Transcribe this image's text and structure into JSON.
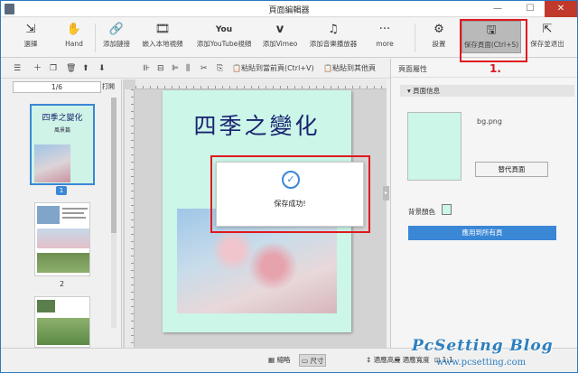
{
  "window": {
    "title": "頁面編輯器"
  },
  "toolbar": {
    "items": [
      {
        "label": "選擇",
        "icon": "selection-arrow-icon"
      },
      {
        "label": "Hand",
        "icon": "hand-icon"
      },
      {
        "label": "添加鏈接",
        "icon": "link-icon"
      },
      {
        "label": "嵌入本地視頻",
        "icon": "film-icon"
      },
      {
        "label": "添加YouTube視頻",
        "icon": "youtube-icon"
      },
      {
        "label": "添加Vimeo",
        "icon": "vimeo-icon"
      },
      {
        "label": "添加音樂播放器",
        "icon": "music-note-icon"
      },
      {
        "label": "more",
        "icon": "more-dots-icon"
      },
      {
        "label": "設置",
        "icon": "gear-icon"
      },
      {
        "label": "保存頁面(Ctrl+S)",
        "icon": "save-icon"
      },
      {
        "label": "保存並退出",
        "icon": "exit-icon"
      }
    ]
  },
  "step_marker": "1.",
  "subbar": {
    "paste_current": "粘貼到當前頁(Ctrl+V)",
    "paste_other": "粘貼到其他頁"
  },
  "left_panel": {
    "page_counter": "1/6",
    "print": "打開",
    "thumb1_title": "四季之變化",
    "thumb1_subtitle": "風景篇",
    "page_labels": [
      "1",
      "2"
    ]
  },
  "page": {
    "title": "四季之變化"
  },
  "dialog": {
    "message": "保存成功!"
  },
  "right_panel": {
    "header": "頁面屬性",
    "section": "頁面信息",
    "bg_filename": "bg.png",
    "replace_button": "替代頁面",
    "bg_color_label": "背景顏色",
    "bg_color": "#cbf6e8",
    "apply_all": "應用到所有頁"
  },
  "statusbar": {
    "thumb_view": "縮略",
    "actual_size": "尺寸",
    "fit_height": "適應高度",
    "fit_width": "適應寬度",
    "zoom": "1:1"
  },
  "watermark": {
    "brand": "PcSetting Blog",
    "url": "www.pcsetting.com"
  }
}
